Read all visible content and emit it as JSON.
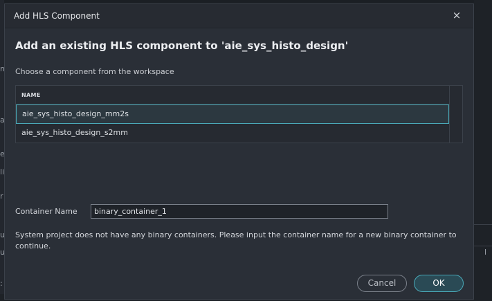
{
  "background": {
    "left_letters": [
      "n",
      "a",
      "e",
      "li",
      "r",
      "u",
      "u",
      ":"
    ],
    "right_letter": "l"
  },
  "dialog": {
    "title": "Add HLS Component",
    "close_glyph": "×",
    "heading": "Add an existing HLS component to 'aie_sys_histo_design'",
    "subheading": "Choose a component from the workspace",
    "table": {
      "column_header": "NAME",
      "rows": [
        "aie_sys_histo_design_mm2s",
        "aie_sys_histo_design_s2mm"
      ],
      "selected_index": 0
    },
    "container": {
      "label": "Container Name",
      "value": "binary_container_1"
    },
    "info": "System project does not have any binary containers. Please input the container name for a new binary container to continue.",
    "buttons": {
      "cancel": "Cancel",
      "ok": "OK"
    }
  },
  "colors": {
    "accent": "#4aa9b8",
    "dialog_bg": "#2a2f37",
    "ok_bg": "#2a4a55"
  }
}
